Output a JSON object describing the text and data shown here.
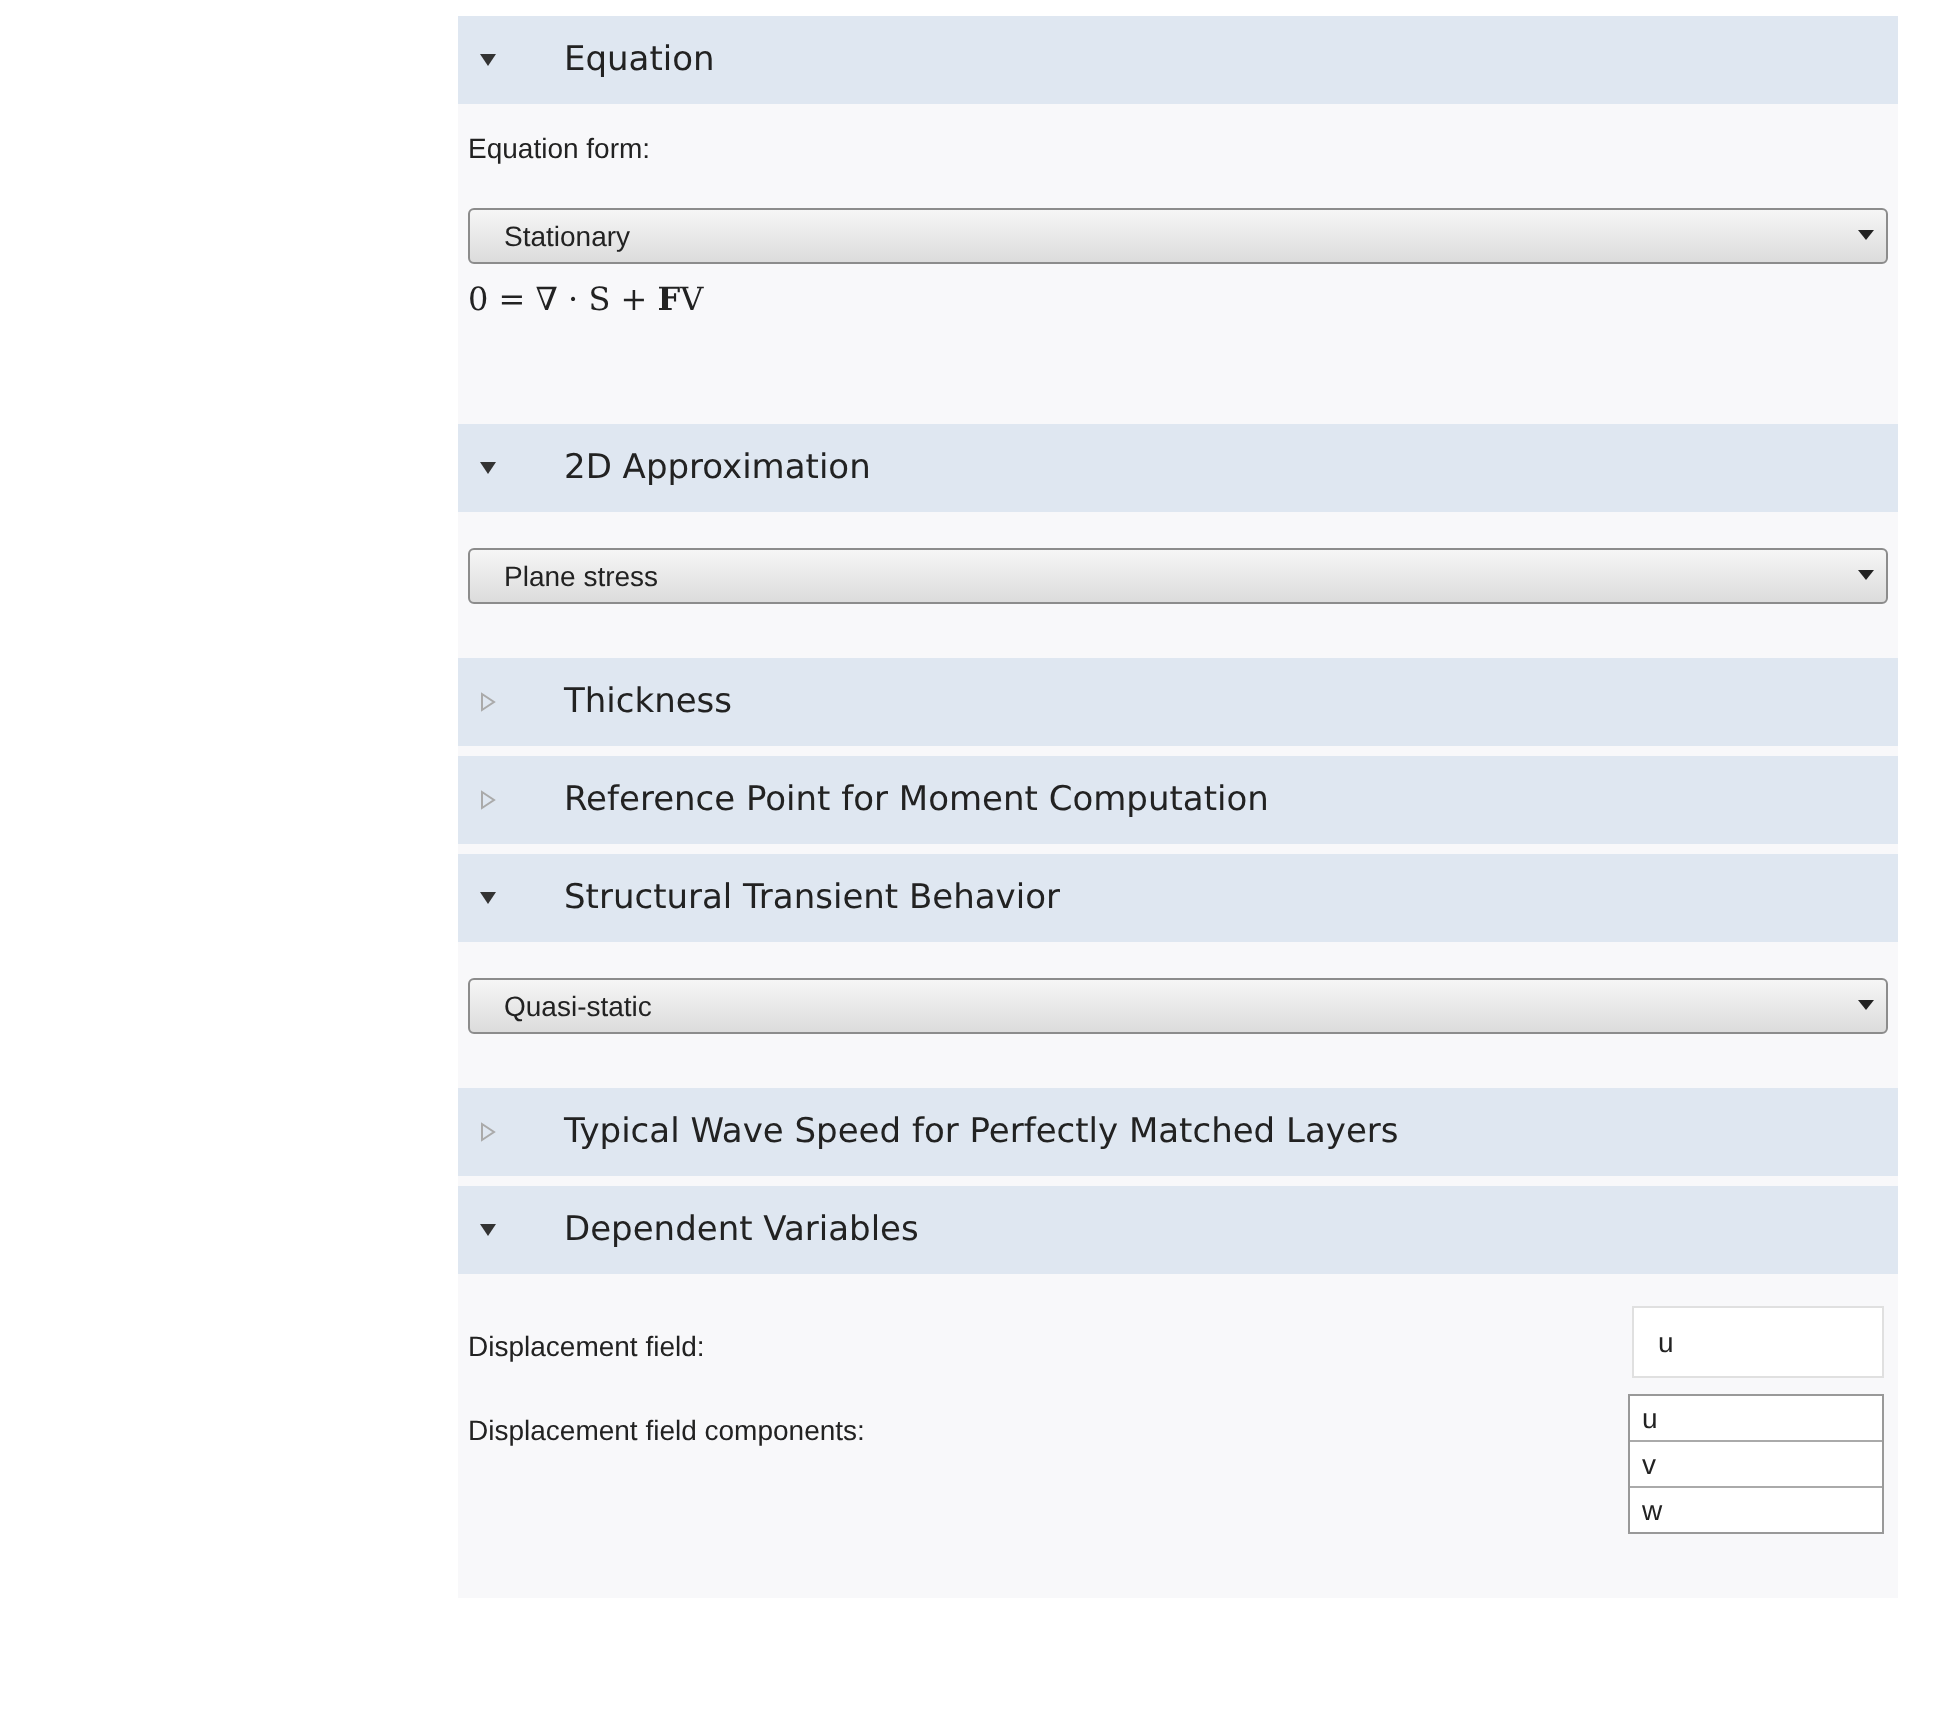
{
  "sections": [
    {
      "title": "Equation",
      "expanded": true,
      "items": [
        {
          "kind": "label",
          "text": "Equation form:"
        },
        {
          "kind": "select",
          "value": "Stationary"
        },
        {
          "kind": "equation",
          "text": "0 = ∇ · S + **F**V"
        }
      ]
    },
    {
      "title": "2D Approximation",
      "expanded": true,
      "items": [
        {
          "kind": "select",
          "value": "Plane stress"
        }
      ]
    },
    {
      "title": "Thickness",
      "expanded": false
    },
    {
      "title": "Reference Point for Moment Computation",
      "expanded": false
    },
    {
      "title": "Structural Transient Behavior",
      "expanded": true,
      "items": [
        {
          "kind": "select",
          "value": "Quasi-static"
        }
      ]
    },
    {
      "title": "Typical Wave Speed for Perfectly Matched Layers",
      "expanded": false
    },
    {
      "title": "Dependent Variables",
      "expanded": true,
      "items": [
        {
          "kind": "field",
          "label": "Displacement field:",
          "value": "u"
        },
        {
          "kind": "table",
          "label": "Displacement field components:",
          "cells": [
            "u",
            "v",
            "w"
          ]
        }
      ]
    }
  ]
}
